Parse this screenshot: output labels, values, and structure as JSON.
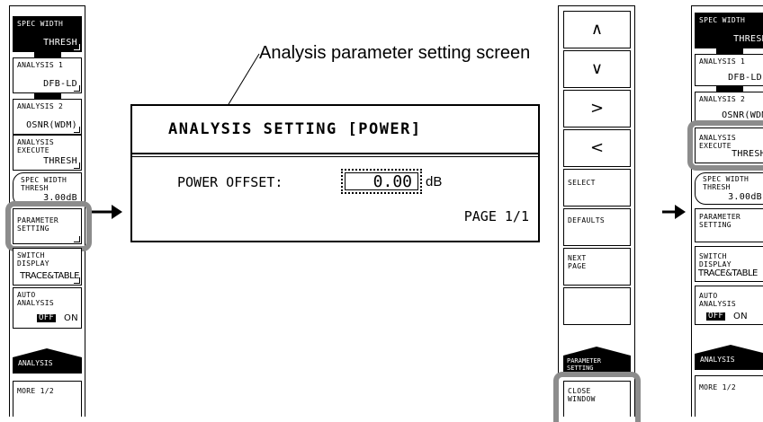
{
  "annotation": "Analysis parameter setting screen",
  "left_menu": {
    "items": [
      {
        "label": "SPEC WIDTH",
        "value": "THRESH"
      },
      {
        "label": "ANALYSIS 1",
        "value": "DFB-LD"
      },
      {
        "label": "ANALYSIS 2",
        "value": "OSNR(WDM)"
      },
      {
        "label": "ANALYSIS\nEXECUTE",
        "value": "THRESH"
      },
      {
        "label": "SPEC WIDTH\nTHRESH",
        "value": "3.00dB"
      },
      {
        "label": "PARAMETER\nSETTING",
        "value": ""
      },
      {
        "label": "SWITCH\nDISPLAY",
        "value": "TRACE&TABLE"
      },
      {
        "label": "AUTO\nANALYSIS",
        "off": "OFF",
        "on": "ON"
      },
      {
        "label": "ANALYSIS",
        "value": ""
      },
      {
        "label": "MORE 1/2",
        "value": ""
      }
    ]
  },
  "dialog": {
    "title": "ANALYSIS SETTING [POWER]",
    "field_label": "POWER OFFSET:",
    "field_value": "0.00",
    "unit": "dB",
    "page": "PAGE 1/1"
  },
  "right_menu": {
    "up": "∧",
    "down": "∨",
    "right": ">",
    "left": "<",
    "select": "SELECT",
    "defaults": "DEFAULTS",
    "next_page": "NEXT\nPAGE",
    "param_tab": "PARAMETER\nSETTING",
    "close": "CLOSE\nWINDOW"
  },
  "far_right_menu": {
    "items": [
      {
        "label": "SPEC WIDTH",
        "value": "THRESH"
      },
      {
        "label": "ANALYSIS 1",
        "value": "DFB-LD"
      },
      {
        "label": "ANALYSIS 2",
        "value": "OSNR(WDM)"
      },
      {
        "label": "ANALYSIS\nEXECUTE",
        "value": "THRESH"
      },
      {
        "label": "SPEC WIDTH\nTHRESH",
        "value": "3.00dB"
      },
      {
        "label": "PARAMETER\nSETTING",
        "value": ""
      },
      {
        "label": "SWITCH\nDISPLAY",
        "value": "TRACE&TABLE"
      },
      {
        "label": "AUTO\nANALYSIS",
        "off": "OFF",
        "on": "ON"
      },
      {
        "label": "ANALYSIS",
        "value": ""
      },
      {
        "label": "MORE 1/2",
        "value": ""
      }
    ]
  },
  "colors": {
    "highlight": "#8c8c8c"
  }
}
